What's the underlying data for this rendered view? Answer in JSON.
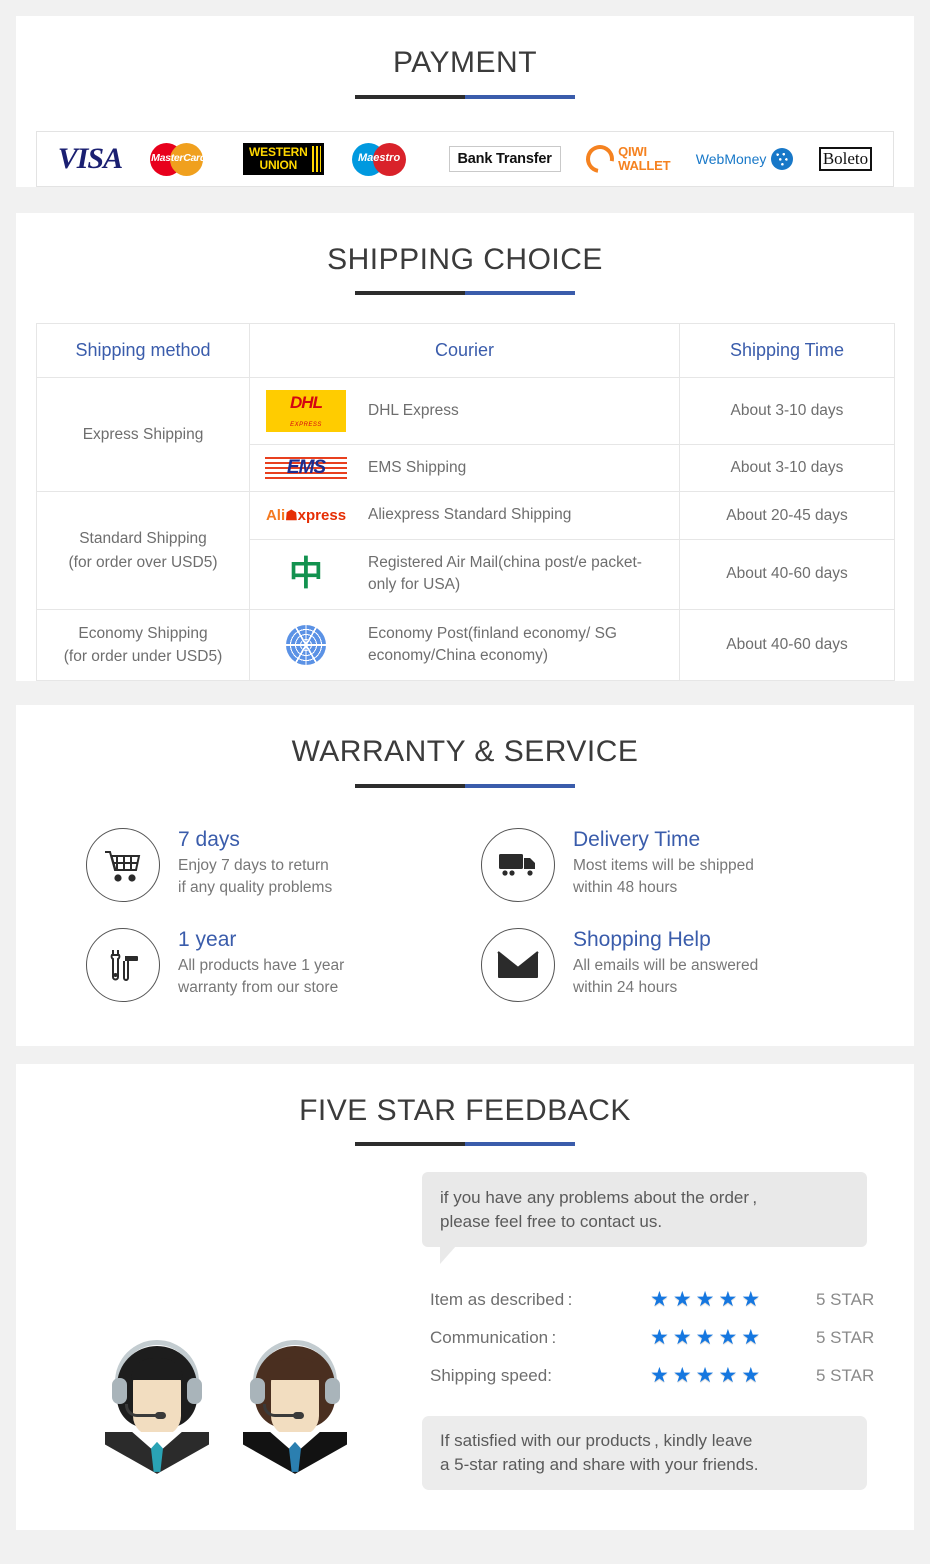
{
  "payment": {
    "title": "PAYMENT",
    "methods": [
      {
        "name": "visa-logo",
        "label": "VISA"
      },
      {
        "name": "mastercard-logo",
        "label": "MasterCard"
      },
      {
        "name": "western-union-logo",
        "label_line1": "WESTERN",
        "label_line2": "UNION"
      },
      {
        "name": "maestro-logo",
        "label": "Maestro"
      },
      {
        "name": "bank-transfer-logo",
        "label": "Bank Transfer"
      },
      {
        "name": "qiwi-wallet-logo",
        "label_line1": "QIWI",
        "label_line2": "WALLET"
      },
      {
        "name": "webmoney-logo",
        "label": "WebMoney"
      },
      {
        "name": "boleto-logo",
        "label": "Boleto"
      }
    ]
  },
  "shipping": {
    "title": "SHIPPING CHOICE",
    "columns": [
      "Shipping method",
      "Courier",
      "Shipping Time"
    ],
    "rows": [
      {
        "method": "Express Shipping",
        "method_sub": "",
        "method_rowspan": 2,
        "courier_logo": "dhl-logo",
        "courier": "DHL Express",
        "time": "About 3-10 days"
      },
      {
        "method": "",
        "method_rowspan": 0,
        "courier_logo": "ems-logo",
        "courier": "EMS Shipping",
        "time": "About 3-10 days"
      },
      {
        "method": "Standard Shipping",
        "method_sub": "(for order over USD5)",
        "method_rowspan": 2,
        "courier_logo": "aliexpress-logo",
        "courier": "Aliexpress Standard Shipping",
        "time": "About 20-45 days"
      },
      {
        "method": "",
        "method_rowspan": 0,
        "courier_logo": "china-post-logo",
        "courier": "Registered Air Mail(china post/e packet-only for USA)",
        "time": "About 40-60 days"
      },
      {
        "method": "Economy Shipping",
        "method_sub": "(for order under USD5)",
        "method_rowspan": 1,
        "courier_logo": "united-nations-logo",
        "courier": "Economy Post(finland economy/ SG economy/China economy)",
        "time": "About 40-60 days"
      }
    ],
    "logo_labels": {
      "dhl_main": "DHL",
      "dhl_sub": "EXPRESS",
      "ems": "EMS",
      "ali_a": "Ali",
      "ali_cart": "☗",
      "ali_x": "xpress"
    }
  },
  "warranty": {
    "title": "WARRANTY & SERVICE",
    "items": [
      {
        "icon": "shopping-cart-icon",
        "title": "7 days",
        "line1": "Enjoy 7 days to return",
        "line2": "if any quality problems"
      },
      {
        "icon": "delivery-truck-icon",
        "title": "Delivery Time",
        "line1": "Most items will be shipped",
        "line2": "within 48 hours"
      },
      {
        "icon": "tools-icon",
        "title": "1 year",
        "line1": "All products have 1 year",
        "line2": "warranty from our store"
      },
      {
        "icon": "envelope-icon",
        "title": "Shopping Help",
        "line1": "All emails will be answered",
        "line2": "within 24 hours"
      }
    ]
  },
  "feedback": {
    "title": "FIVE STAR FEEDBACK",
    "bubble_top_line1": "if you have any problems about the order ,",
    "bubble_top_line2": "please feel free to contact us.",
    "ratings": [
      {
        "label": "Item as described :",
        "stars": 5,
        "value": "5 STAR"
      },
      {
        "label": "Communication :",
        "stars": 5,
        "value": "5 STAR"
      },
      {
        "label": "Shipping speed:",
        "stars": 5,
        "value": "5 STAR"
      }
    ],
    "star_glyph": "★",
    "bubble_bottom_line1": "If satisfied with our products , kindly leave",
    "bubble_bottom_line2": "a 5-star rating and share with your friends."
  },
  "colors": {
    "accent_blue": "#3a5cab",
    "rule_dark": "#2d2d2d",
    "text_gray": "#6e6e6e",
    "star_blue": "#1577e0",
    "page_bg": "#f1f1f1"
  }
}
